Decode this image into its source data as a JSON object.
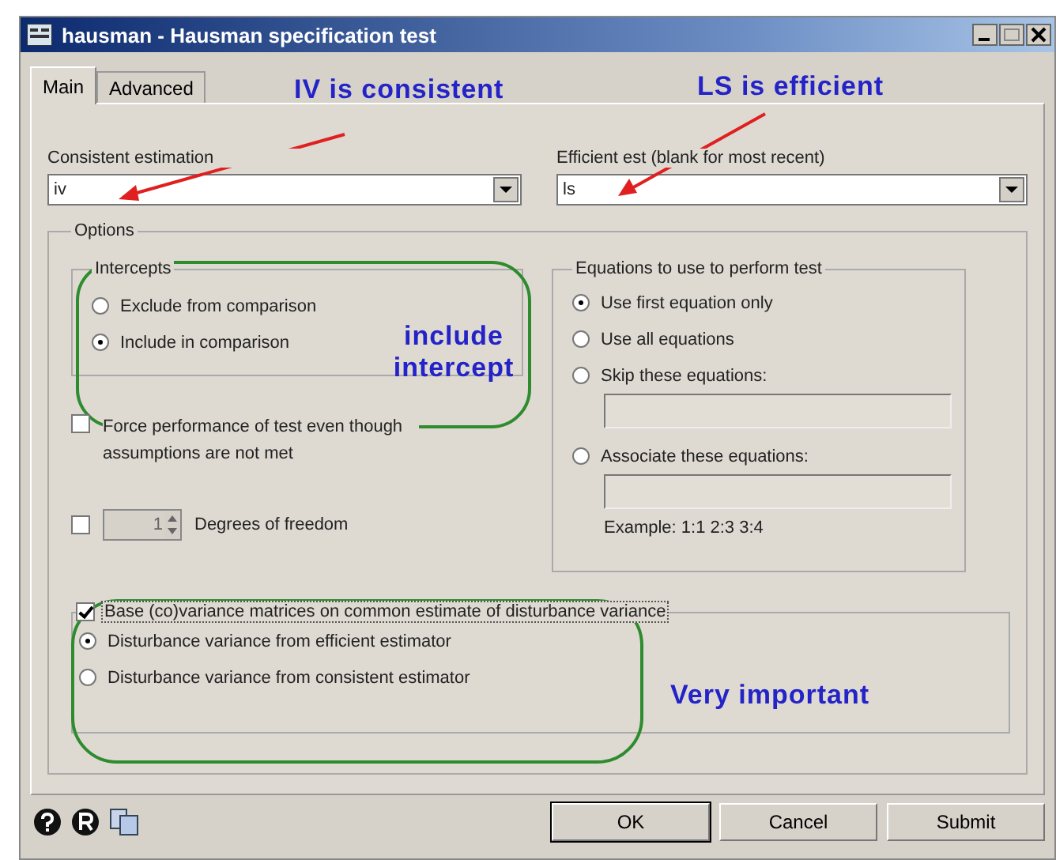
{
  "window": {
    "title": "hausman - Hausman specification test"
  },
  "tabs": [
    {
      "label": "Main",
      "selected": true
    },
    {
      "label": "Advanced",
      "selected": false
    }
  ],
  "estimators": [
    {
      "label": "Consistent estimation",
      "value": "iv"
    },
    {
      "label": "Efficient est (blank for most recent)",
      "value": "ls"
    }
  ],
  "options": {
    "title": "Options",
    "intercepts": {
      "title": "Intercepts",
      "choices": [
        {
          "label": "Exclude from comparison",
          "selected": false
        },
        {
          "label": "Include in comparison",
          "selected": true
        }
      ]
    },
    "force": {
      "label": "Force performance of test even though assumptions are not met",
      "checked": false
    },
    "dof": {
      "checked": false,
      "value": "1",
      "label": "Degrees of freedom"
    },
    "equations": {
      "title": "Equations to use to perform test",
      "choices": [
        {
          "label": "Use first equation only",
          "selected": true,
          "kind": "plain"
        },
        {
          "label": "Use all equations",
          "selected": false,
          "kind": "plain"
        },
        {
          "label": "Skip these equations:",
          "selected": false,
          "kind": "field"
        },
        {
          "label": "Associate these equations:",
          "selected": false,
          "kind": "field"
        }
      ],
      "example": "Example: 1:1 2:3 3:4"
    },
    "base": {
      "label": "Base (co)variance matrices on common estimate of disturbance variance",
      "checked": true,
      "choices": [
        {
          "label": "Disturbance variance from efficient estimator",
          "selected": true
        },
        {
          "label": "Disturbance variance from consistent estimator",
          "selected": false
        }
      ]
    }
  },
  "buttons": [
    {
      "label": "OK",
      "default": true
    },
    {
      "label": "Cancel",
      "default": false
    },
    {
      "label": "Submit",
      "default": false
    }
  ],
  "annotations": [
    "IV is consistent",
    "LS is efficient",
    "include intercept",
    "Very important"
  ]
}
